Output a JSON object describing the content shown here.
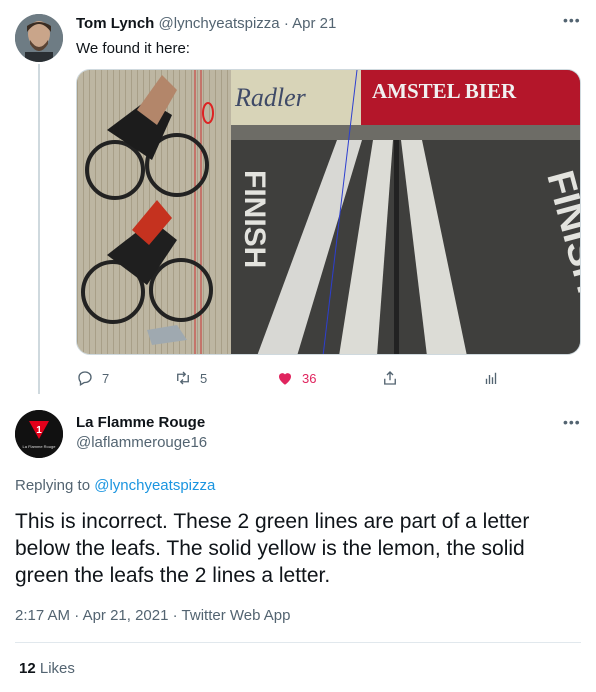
{
  "tweet1": {
    "name": "Tom Lynch",
    "handle": "@lynchyeatspizza",
    "separator": "·",
    "date": "Apr 21",
    "text": "We found it here:",
    "image_texts": {
      "sponsor1": "Radler",
      "sponsor2": "AMSTEL BIER",
      "road1": "FINISH",
      "road2": "FINISH"
    },
    "actions": {
      "replies": "7",
      "retweets": "5",
      "likes": "36"
    },
    "icons": [
      "more-icon",
      "reply-icon",
      "retweet-icon",
      "heart-icon",
      "share-icon",
      "analytics-icon"
    ]
  },
  "tweet2": {
    "name": "La Flamme Rouge",
    "handle": "@laflammerouge16",
    "avatar_mark": "1",
    "avatar_text": "La Flamme Rouge",
    "replying_label": "Replying to",
    "replying_to": "@lynchyeatspizza",
    "text": "This is incorrect. These 2 green lines are part of a letter below the leafs. The solid yellow is the lemon, the solid green the leafs the 2 lines a letter.",
    "time": "2:17 AM",
    "dot": "·",
    "date": "Apr 21, 2021",
    "source": "Twitter Web App",
    "likes_count": "12",
    "likes_label": "Likes"
  },
  "colors": {
    "link": "#1b95e0",
    "like": "#e0245e",
    "muted": "#536471",
    "brand_red": "#e2001a"
  }
}
